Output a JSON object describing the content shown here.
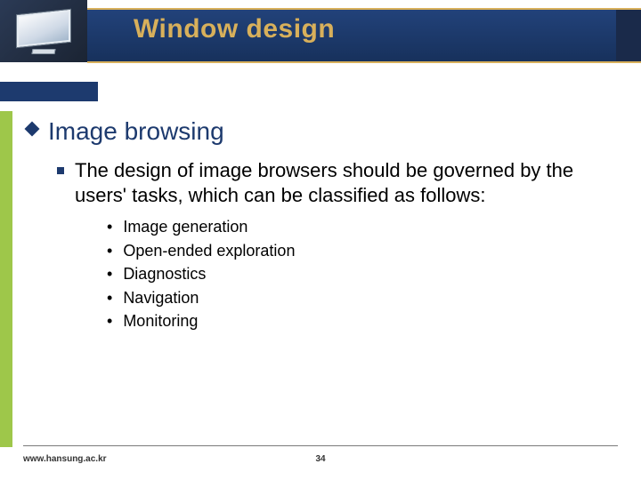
{
  "title": "Window design",
  "heading": "Image browsing",
  "body_text": "The design of image browsers should be governed by the users' tasks, which can be classified as follows:",
  "list": [
    "Image generation",
    "Open-ended exploration",
    "Diagnostics",
    "Navigation",
    "Monitoring"
  ],
  "footer": {
    "url": "www.hansung.ac.kr",
    "page_number": "34"
  }
}
